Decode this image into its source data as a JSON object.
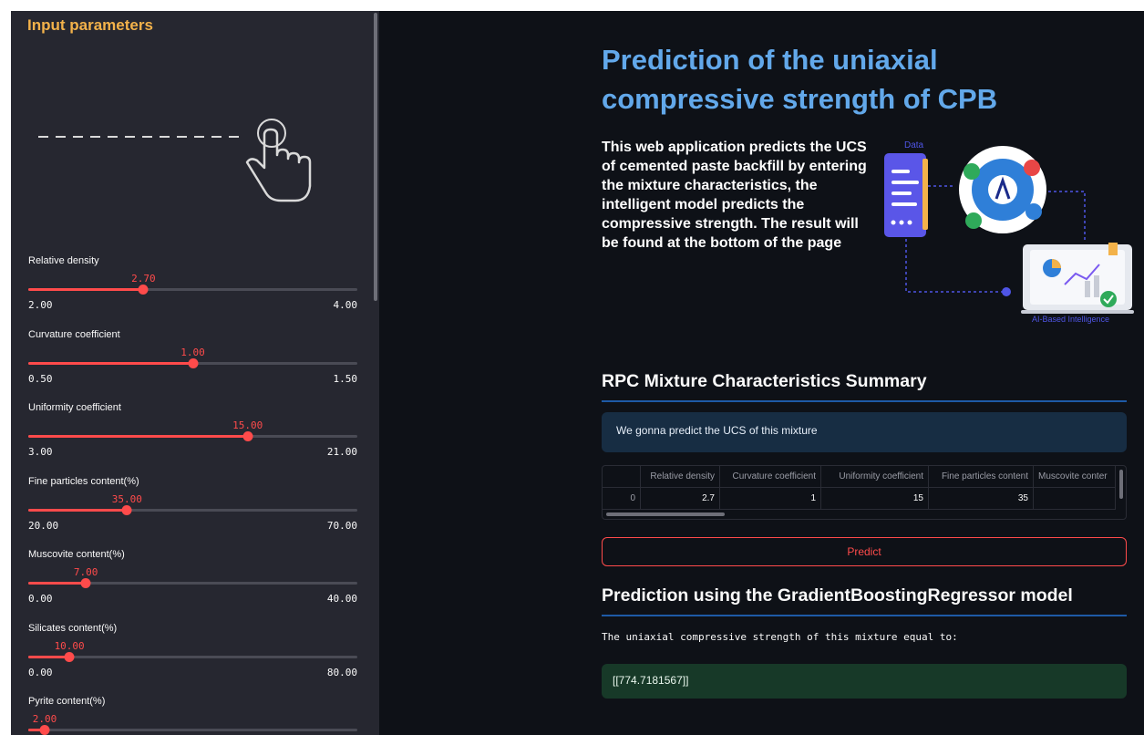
{
  "sidebar": {
    "title": "Input parameters",
    "sliders": [
      {
        "label": "Relative density",
        "value": "2.70",
        "min": "2.00",
        "max": "4.00",
        "fraction": 0.35
      },
      {
        "label": "Curvature coefficient",
        "value": "1.00",
        "min": "0.50",
        "max": "1.50",
        "fraction": 0.5
      },
      {
        "label": "Uniformity coefficient",
        "value": "15.00",
        "min": "3.00",
        "max": "21.00",
        "fraction": 0.6667
      },
      {
        "label": "Fine particles content(%)",
        "value": "35.00",
        "min": "20.00",
        "max": "70.00",
        "fraction": 0.3
      },
      {
        "label": "Muscovite content(%)",
        "value": "7.00",
        "min": "0.00",
        "max": "40.00",
        "fraction": 0.175
      },
      {
        "label": "Silicates content(%)",
        "value": "10.00",
        "min": "0.00",
        "max": "80.00",
        "fraction": 0.125
      },
      {
        "label": "Pyrite content(%)",
        "value": "2.00",
        "min": "",
        "max": "",
        "fraction": 0.05
      }
    ]
  },
  "main": {
    "title": "Prediction of the uniaxial compressive strength of CPB",
    "intro": "This web application predicts the UCS of cemented paste backfill by entering the mixture characteristics, the intelligent model predicts the compressive strength. The result will be found at the bottom of the page",
    "graphic": {
      "data_label": "Data",
      "ai_label": "AI-Based Intelligence"
    },
    "summary_header": "RPC Mixture Characteristics Summary",
    "info_text": "We gonna predict the UCS of this mixture",
    "table": {
      "columns": [
        "Relative density",
        "Curvature coefficient",
        "Uniformity coefficient",
        "Fine particles content",
        "Muscovite conter"
      ],
      "rows": [
        {
          "index": "0",
          "values": [
            "2.7",
            "1",
            "15",
            "35",
            ""
          ]
        }
      ]
    },
    "predict_label": "Predict",
    "prediction_header": "Prediction using the GradientBoostingRegressor model",
    "result_caption": "The uniaxial compressive strength of this mixture equal to:",
    "result_value": "[[774.7181567]]"
  },
  "colors": {
    "accent": "#ff4b4b",
    "title_blue": "#62a8ea",
    "sidebar_title": "#f3b24a",
    "info_bg": "#172d43",
    "success_bg": "#173928"
  },
  "icons": [
    "hand-pointer-icon",
    "document-icon",
    "gear-icon",
    "laptop-chart-icon"
  ]
}
